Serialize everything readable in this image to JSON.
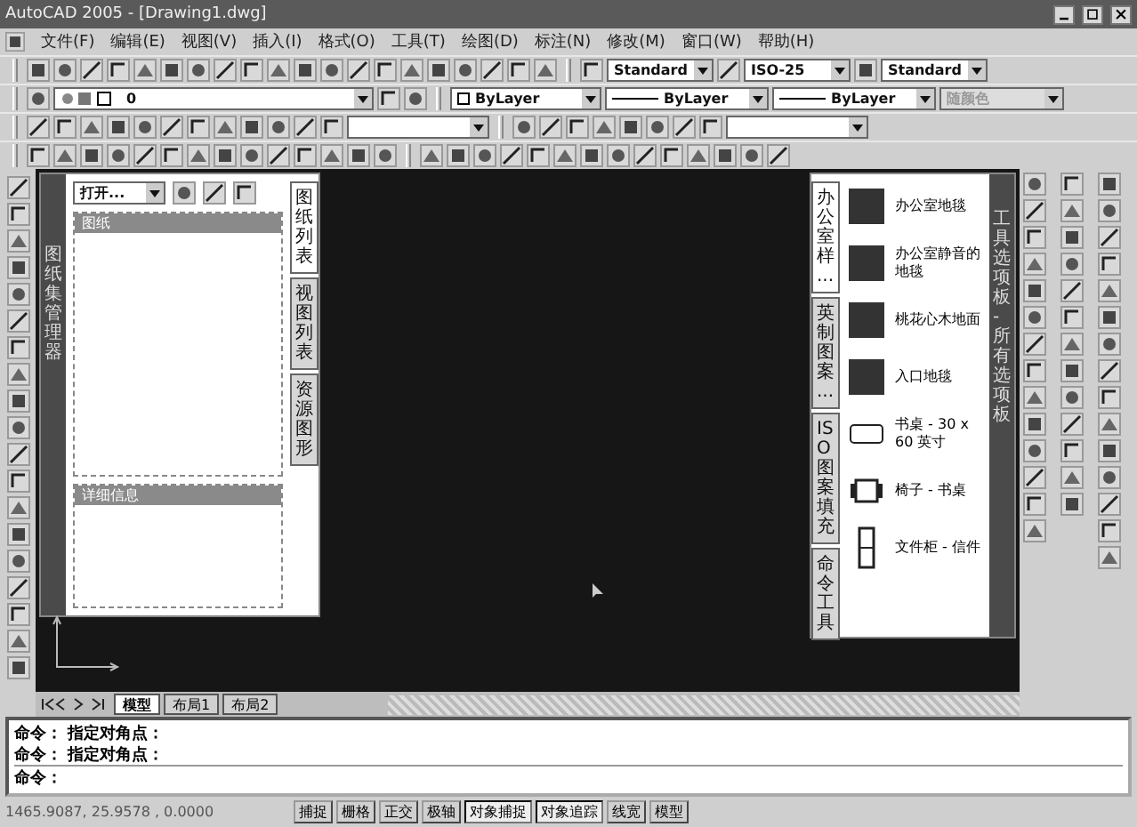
{
  "window": {
    "title": "AutoCAD 2005 - [Drawing1.dwg]"
  },
  "menu": [
    "文件(F)",
    "编辑(E)",
    "视图(V)",
    "插入(I)",
    "格式(O)",
    "工具(T)",
    "绘图(D)",
    "标注(N)",
    "修改(M)",
    "窗口(W)",
    "帮助(H)"
  ],
  "styles_toolbar": {
    "text_style": "Standard",
    "dim_style": "ISO-25",
    "table_style": "Standard"
  },
  "layer": {
    "name": "0"
  },
  "properties": [
    {
      "value": "ByLayer",
      "kind": "color",
      "disabled": false
    },
    {
      "value": "ByLayer",
      "kind": "line",
      "disabled": false
    },
    {
      "value": "ByLayer",
      "kind": "line",
      "disabled": false
    },
    {
      "value": "随颜色",
      "kind": "plain",
      "disabled": true
    }
  ],
  "sheet_set_manager": {
    "dropdown": "打开...",
    "side_title": "图纸集管理器",
    "tabs": [
      {
        "label": "图纸列表",
        "selected": true
      },
      {
        "label": "视图列表",
        "selected": false
      },
      {
        "label": "资源图形",
        "selected": false
      }
    ],
    "panels": [
      {
        "title": "图纸"
      },
      {
        "title": "详细信息"
      }
    ]
  },
  "tool_palette": {
    "side_title": "工具选项板 - 所有选项板",
    "tabs": [
      {
        "label": "办公室样...",
        "selected": true
      },
      {
        "label": "英制图案...",
        "selected": false
      },
      {
        "label": "ISO 图案填充",
        "selected": false
      },
      {
        "label": "命令工具",
        "selected": false
      }
    ],
    "items": [
      {
        "label": "办公室地毯",
        "kind": "swatch"
      },
      {
        "label": "办公室静音的地毯",
        "kind": "swatch"
      },
      {
        "label": "桃花心木地面",
        "kind": "swatch"
      },
      {
        "label": "入口地毯",
        "kind": "swatch"
      },
      {
        "label": "书桌 - 30 x 60 英寸",
        "kind": "desk"
      },
      {
        "label": "椅子 - 书桌",
        "kind": "chair"
      },
      {
        "label": "文件柜 - 信件",
        "kind": "cabinet"
      }
    ]
  },
  "layout_tabs": [
    {
      "label": "模型",
      "selected": true
    },
    {
      "label": "布局1",
      "selected": false
    },
    {
      "label": "布局2",
      "selected": false
    }
  ],
  "command": {
    "history": [
      "命令： 指定对角点：",
      "命令： 指定对角点："
    ],
    "prompt": "命令："
  },
  "status": {
    "coordinates": "1465.9087, 25.9578 , 0.0000",
    "toggles": [
      {
        "label": "捕捉",
        "on": false
      },
      {
        "label": "栅格",
        "on": false
      },
      {
        "label": "正交",
        "on": false
      },
      {
        "label": "极轴",
        "on": false
      },
      {
        "label": "对象捕捉",
        "on": true
      },
      {
        "label": "对象追踪",
        "on": true
      },
      {
        "label": "线宽",
        "on": false
      },
      {
        "label": "模型",
        "on": false
      }
    ]
  }
}
